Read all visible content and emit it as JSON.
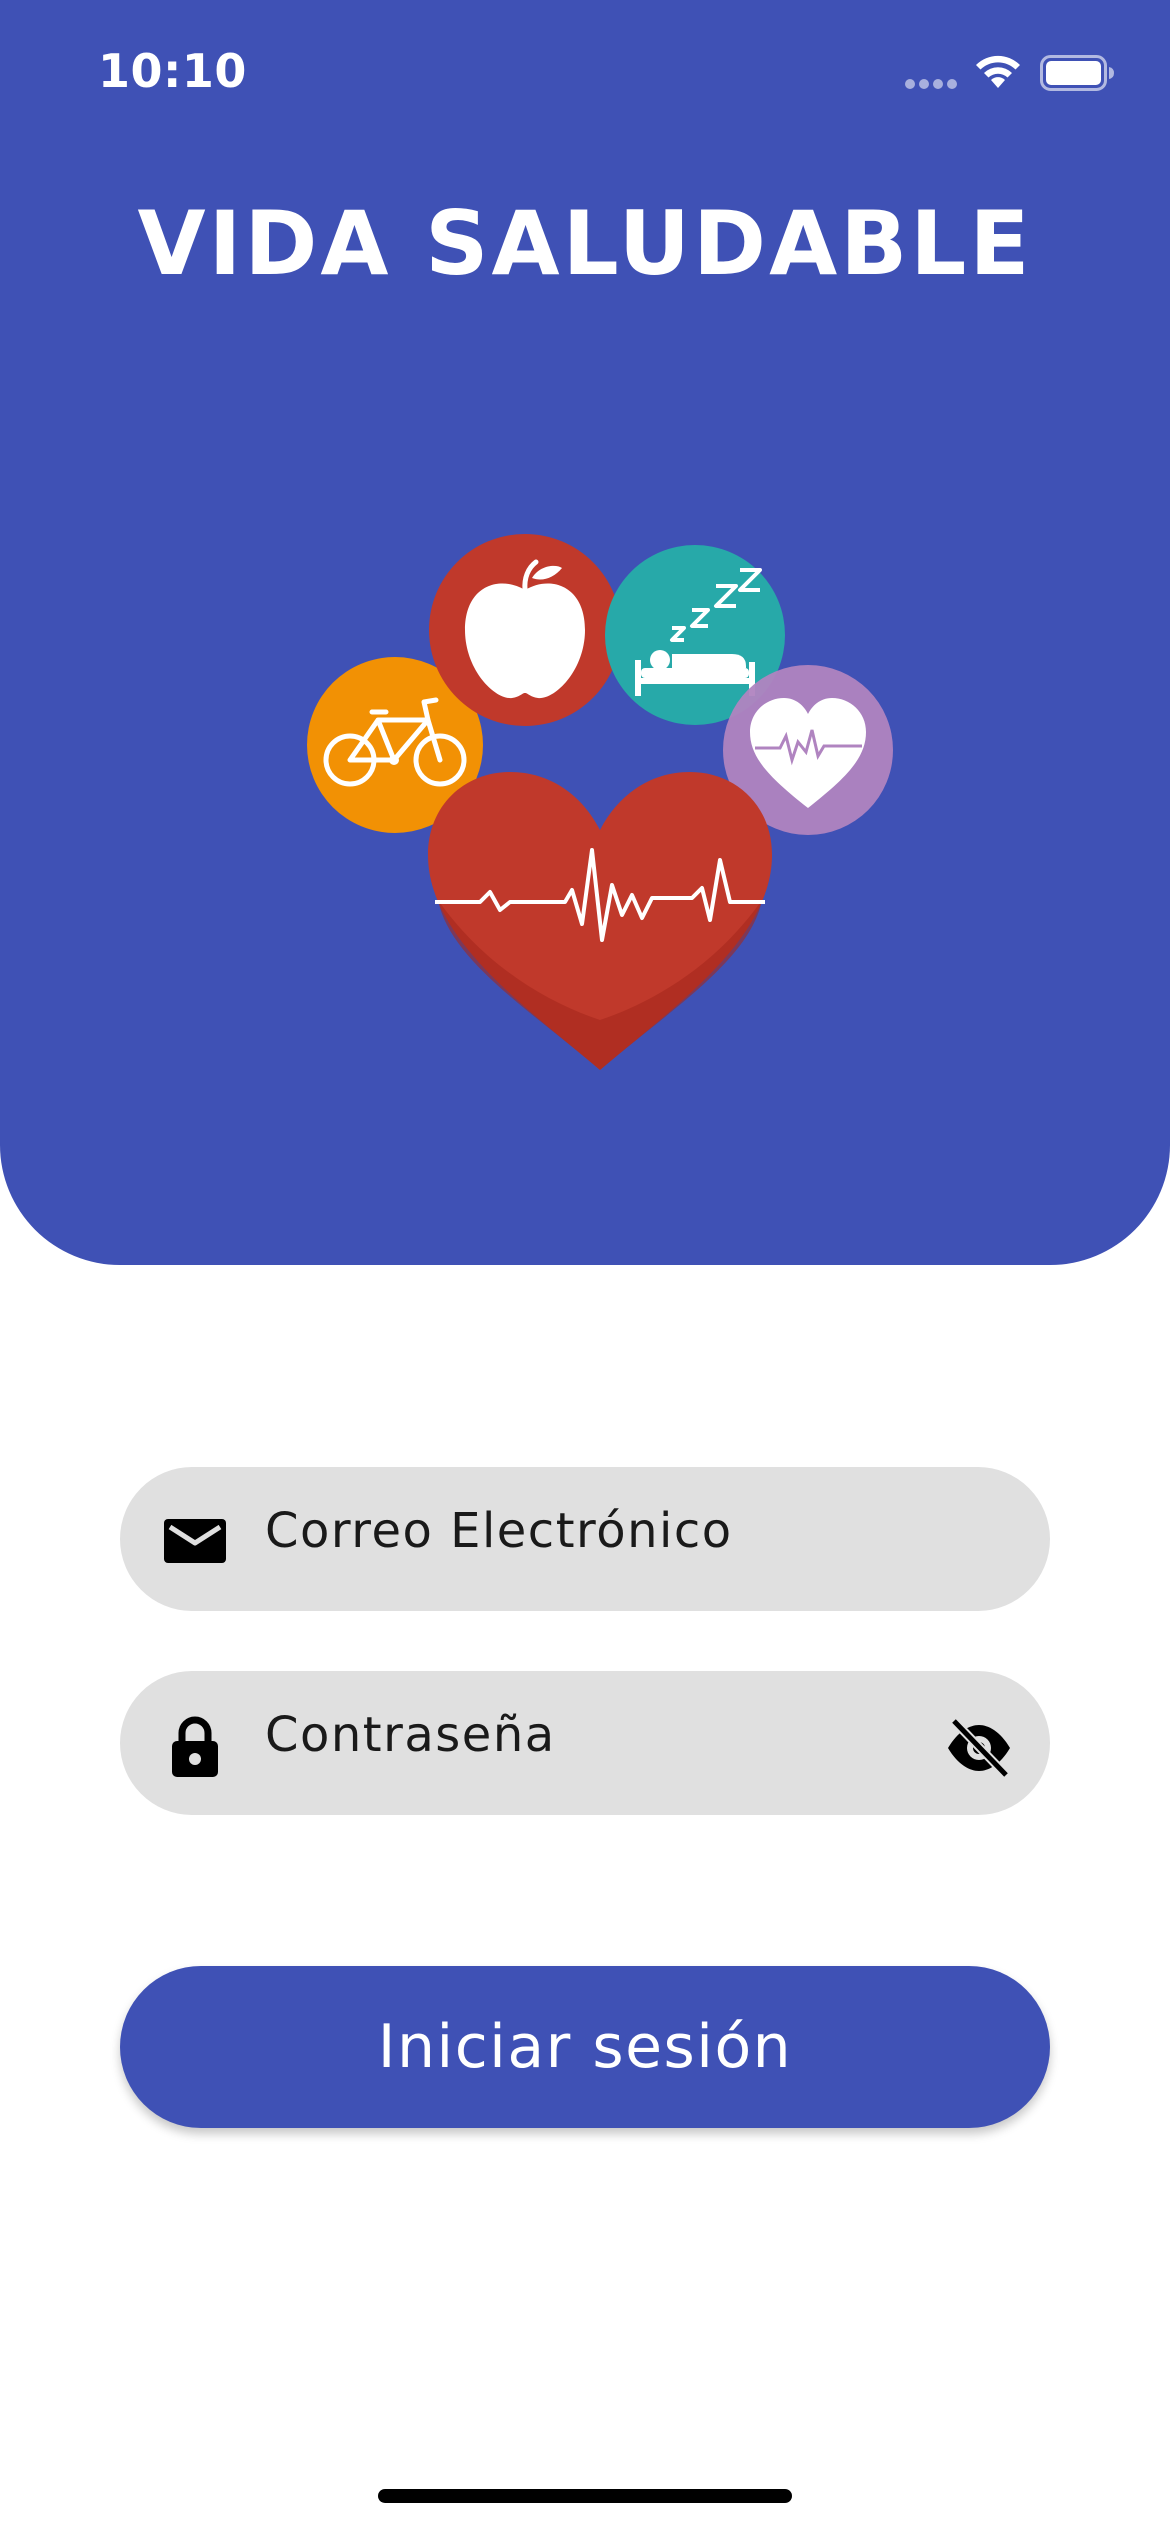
{
  "status_bar": {
    "time": "10:10"
  },
  "header": {
    "title": "VIDA SALUDABLE",
    "background_color": "#3f51b5",
    "logo_icons": [
      "bicycle-icon",
      "apple-icon",
      "sleep-bed-icon",
      "heart-small-icon",
      "heartbeat-heart-icon"
    ]
  },
  "form": {
    "email": {
      "placeholder": "Correo Electrónico",
      "value": "",
      "icon": "mail-icon"
    },
    "password": {
      "placeholder": "Contraseña",
      "value": "",
      "icon": "lock-icon",
      "toggle_icon": "eye-off-icon"
    },
    "field_background": "#e0e0e0",
    "submit_label": "Iniciar sesión",
    "submit_color": "#3f51b5"
  }
}
